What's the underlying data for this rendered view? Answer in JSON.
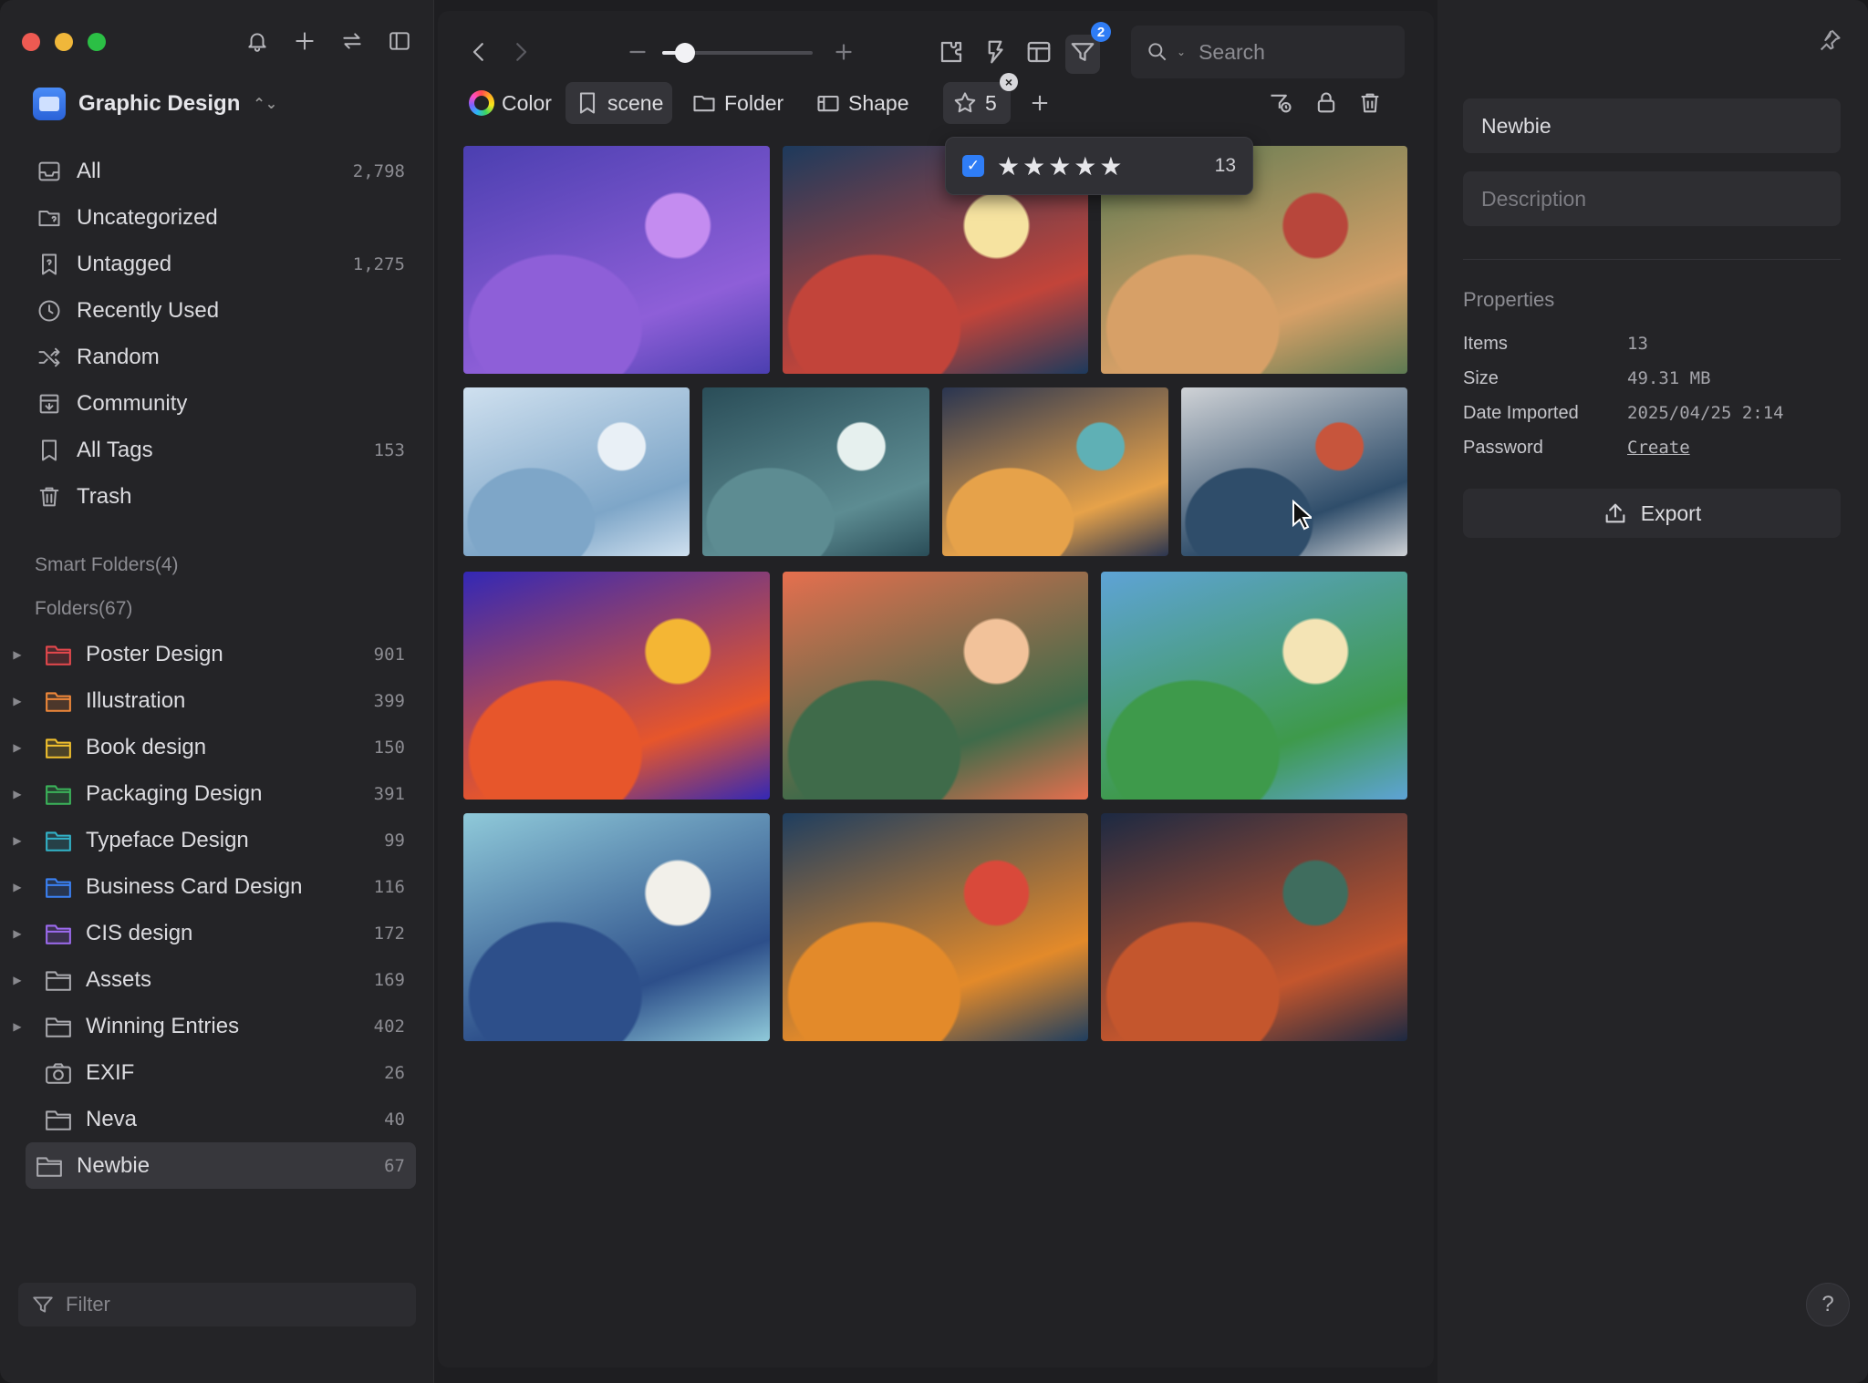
{
  "sidebar": {
    "library": "Graphic Design",
    "nav": [
      {
        "label": "All",
        "count": "2,798",
        "icon": "inbox-icon"
      },
      {
        "label": "Uncategorized",
        "count": "",
        "icon": "folder-question-icon"
      },
      {
        "label": "Untagged",
        "count": "1,275",
        "icon": "tag-question-icon"
      },
      {
        "label": "Recently Used",
        "count": "",
        "icon": "clock-icon"
      },
      {
        "label": "Random",
        "count": "",
        "icon": "shuffle-icon"
      },
      {
        "label": "Community",
        "count": "",
        "icon": "community-icon"
      },
      {
        "label": "All Tags",
        "count": "153",
        "icon": "bookmark-icon"
      },
      {
        "label": "Trash",
        "count": "",
        "icon": "trash-icon"
      }
    ],
    "smart_folders": "Smart Folders(4)",
    "folders_head": "Folders(67)",
    "folders": [
      {
        "label": "Poster Design",
        "count": "901",
        "color": "#e5484d",
        "caret": true
      },
      {
        "label": "Illustration",
        "count": "399",
        "color": "#f0883a",
        "caret": true
      },
      {
        "label": "Book design",
        "count": "150",
        "color": "#f2c12e",
        "caret": true
      },
      {
        "label": "Packaging Design",
        "count": "391",
        "color": "#3bb35a",
        "caret": true
      },
      {
        "label": "Typeface Design",
        "count": "99",
        "color": "#32b3c9",
        "caret": true
      },
      {
        "label": "Business Card Design",
        "count": "116",
        "color": "#3b82f6",
        "caret": true
      },
      {
        "label": "CIS design",
        "count": "172",
        "color": "#9d6bf0",
        "caret": true
      },
      {
        "label": "Assets",
        "count": "169",
        "color": "#a9a9ae",
        "caret": true
      },
      {
        "label": "Winning Entries",
        "count": "402",
        "color": "#a9a9ae",
        "caret": true
      },
      {
        "label": "EXIF",
        "count": "26",
        "color": "#a9a9ae",
        "caret": false,
        "icon": "camera-icon"
      },
      {
        "label": "Neva",
        "count": "40",
        "color": "#a9a9ae",
        "caret": false
      },
      {
        "label": "Newbie",
        "count": "67",
        "color": "#a9a9ae",
        "caret": false,
        "selected": true
      }
    ],
    "filter_placeholder": "Filter"
  },
  "toolbar": {
    "zoom_level": 0.15,
    "filter_badge": "2",
    "search_placeholder": "Search"
  },
  "filterbar": {
    "color": "Color",
    "scene": "scene",
    "folder": "Folder",
    "shape": "Shape",
    "rating": "5"
  },
  "rating_dropdown": {
    "stars": "★★★★★",
    "count": "13"
  },
  "grid": [
    {
      "row": 0,
      "colors": [
        "#4b3fb0",
        "#8e5fd8",
        "#c48cf0"
      ],
      "name": "thumb-gazebo"
    },
    {
      "row": 0,
      "colors": [
        "#1d3a5c",
        "#c2443a",
        "#f6e3a0"
      ],
      "name": "thumb-porch"
    },
    {
      "row": 0,
      "colors": [
        "#5d7a52",
        "#d7a067",
        "#b8463b"
      ],
      "name": "thumb-crowd"
    },
    {
      "row": 1,
      "colors": [
        "#cfe0ef",
        "#7ea6c8",
        "#e9f0f6"
      ],
      "name": "thumb-snow"
    },
    {
      "row": 1,
      "colors": [
        "#2a4d58",
        "#5d8c92",
        "#e6f0ee"
      ],
      "name": "thumb-forest"
    },
    {
      "row": 1,
      "colors": [
        "#2a3550",
        "#e6a24a",
        "#5fb0b5"
      ],
      "name": "thumb-woman-bird"
    },
    {
      "row": 1,
      "colors": [
        "#cfd2d6",
        "#2f4d6a",
        "#c7553c"
      ],
      "name": "thumb-climber"
    },
    {
      "row": 2,
      "colors": [
        "#3328b5",
        "#e7562b",
        "#f4b634"
      ],
      "name": "thumb-barber-cat"
    },
    {
      "row": 2,
      "colors": [
        "#e56f4e",
        "#3f6b4a",
        "#f2c29a"
      ],
      "name": "thumb-windows"
    },
    {
      "row": 2,
      "colors": [
        "#5ea3d6",
        "#3e9a4b",
        "#f4e4b5"
      ],
      "name": "thumb-courier"
    },
    {
      "row": 3,
      "colors": [
        "#8fc9d9",
        "#2d4f8a",
        "#f2f0ea"
      ],
      "name": "thumb-chef"
    },
    {
      "row": 3,
      "colors": [
        "#1f3e5f",
        "#e38a2a",
        "#d9493a"
      ],
      "name": "thumb-vr"
    },
    {
      "row": 3,
      "colors": [
        "#1c2942",
        "#c4562d",
        "#3f6d5e"
      ],
      "name": "thumb-pond"
    }
  ],
  "panel": {
    "name": "Newbie",
    "description_placeholder": "Description",
    "properties_title": "Properties",
    "properties": [
      {
        "key": "Items",
        "value": "13"
      },
      {
        "key": "Size",
        "value": "49.31 MB"
      },
      {
        "key": "Date Imported",
        "value": "2025/04/25 2:14"
      },
      {
        "key": "Password",
        "value": "Create",
        "link": true
      }
    ],
    "export_label": "Export",
    "help": "?"
  }
}
